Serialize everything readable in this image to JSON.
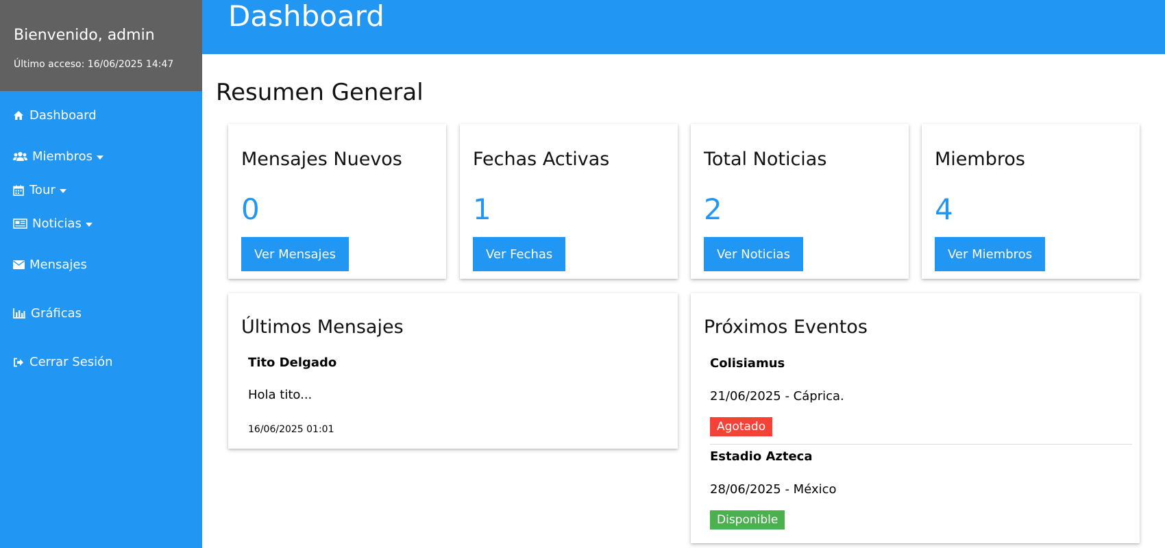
{
  "sidebar": {
    "welcome": "Bienvenido, admin",
    "last_access": "Último acceso: 16/06/2025 14:47",
    "items": [
      {
        "label": "Dashboard",
        "icon": "home-icon"
      },
      {
        "label": "Miembros",
        "icon": "users-icon",
        "dropdown": true
      },
      {
        "label": "Tour",
        "icon": "calendar-icon",
        "dropdown": true
      },
      {
        "label": "Noticias",
        "icon": "newspaper-icon",
        "dropdown": true
      },
      {
        "label": "Mensajes",
        "icon": "envelope-icon"
      },
      {
        "label": "Gráficas",
        "icon": "bar-chart-icon"
      },
      {
        "label": "Cerrar Sesión",
        "icon": "sign-out-icon"
      }
    ]
  },
  "header": {
    "title": "Dashboard"
  },
  "main": {
    "section_title": "Resumen General",
    "stats": [
      {
        "title": "Mensajes Nuevos",
        "value": "0",
        "button": "Ver Mensajes"
      },
      {
        "title": "Fechas Activas",
        "value": "1",
        "button": "Ver Fechas"
      },
      {
        "title": "Total Noticias",
        "value": "2",
        "button": "Ver Noticias"
      },
      {
        "title": "Miembros",
        "value": "4",
        "button": "Ver Miembros"
      }
    ],
    "messages": {
      "title": "Últimos Mensajes",
      "items": [
        {
          "name": "Tito Delgado",
          "text": "Hola tito...",
          "date": "16/06/2025 01:01"
        }
      ]
    },
    "events": {
      "title": "Próximos Eventos",
      "items": [
        {
          "name": "Colisiamus",
          "info": "21/06/2025 - Cáprica.",
          "status": "Agotado",
          "status_color": "#f44336"
        },
        {
          "name": "Estadio Azteca",
          "info": "28/06/2025 - México",
          "status": "Disponible",
          "status_color": "#4caf50"
        }
      ]
    }
  },
  "colors": {
    "primary": "#2196f3",
    "user_box": "#616161",
    "danger": "#f44336",
    "success": "#4caf50"
  }
}
